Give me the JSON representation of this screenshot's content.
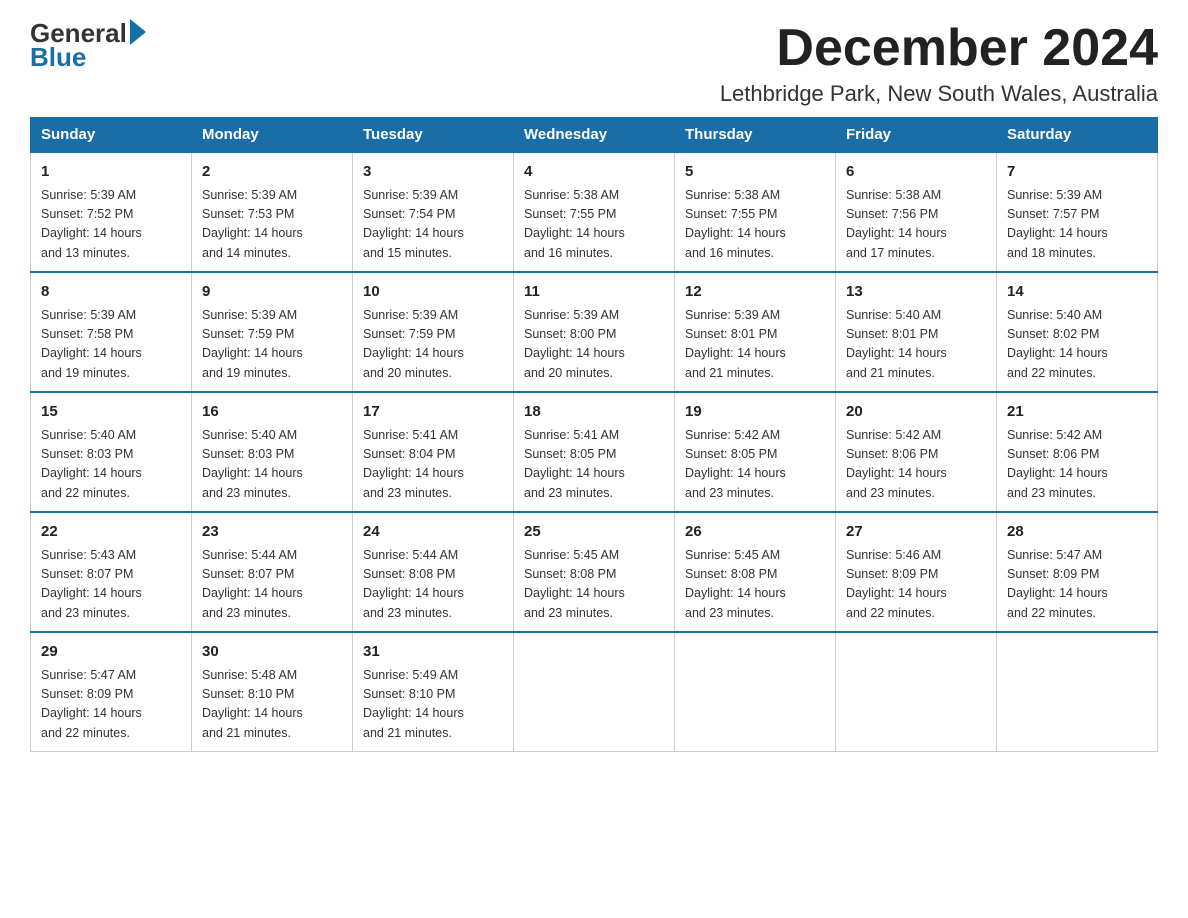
{
  "logo": {
    "general": "General",
    "blue": "Blue"
  },
  "title": {
    "month": "December 2024",
    "location": "Lethbridge Park, New South Wales, Australia"
  },
  "weekdays": [
    "Sunday",
    "Monday",
    "Tuesday",
    "Wednesday",
    "Thursday",
    "Friday",
    "Saturday"
  ],
  "weeks": [
    [
      {
        "day": "1",
        "sunrise": "5:39 AM",
        "sunset": "7:52 PM",
        "daylight": "14 hours and 13 minutes."
      },
      {
        "day": "2",
        "sunrise": "5:39 AM",
        "sunset": "7:53 PM",
        "daylight": "14 hours and 14 minutes."
      },
      {
        "day": "3",
        "sunrise": "5:39 AM",
        "sunset": "7:54 PM",
        "daylight": "14 hours and 15 minutes."
      },
      {
        "day": "4",
        "sunrise": "5:38 AM",
        "sunset": "7:55 PM",
        "daylight": "14 hours and 16 minutes."
      },
      {
        "day": "5",
        "sunrise": "5:38 AM",
        "sunset": "7:55 PM",
        "daylight": "14 hours and 16 minutes."
      },
      {
        "day": "6",
        "sunrise": "5:38 AM",
        "sunset": "7:56 PM",
        "daylight": "14 hours and 17 minutes."
      },
      {
        "day": "7",
        "sunrise": "5:39 AM",
        "sunset": "7:57 PM",
        "daylight": "14 hours and 18 minutes."
      }
    ],
    [
      {
        "day": "8",
        "sunrise": "5:39 AM",
        "sunset": "7:58 PM",
        "daylight": "14 hours and 19 minutes."
      },
      {
        "day": "9",
        "sunrise": "5:39 AM",
        "sunset": "7:59 PM",
        "daylight": "14 hours and 19 minutes."
      },
      {
        "day": "10",
        "sunrise": "5:39 AM",
        "sunset": "7:59 PM",
        "daylight": "14 hours and 20 minutes."
      },
      {
        "day": "11",
        "sunrise": "5:39 AM",
        "sunset": "8:00 PM",
        "daylight": "14 hours and 20 minutes."
      },
      {
        "day": "12",
        "sunrise": "5:39 AM",
        "sunset": "8:01 PM",
        "daylight": "14 hours and 21 minutes."
      },
      {
        "day": "13",
        "sunrise": "5:40 AM",
        "sunset": "8:01 PM",
        "daylight": "14 hours and 21 minutes."
      },
      {
        "day": "14",
        "sunrise": "5:40 AM",
        "sunset": "8:02 PM",
        "daylight": "14 hours and 22 minutes."
      }
    ],
    [
      {
        "day": "15",
        "sunrise": "5:40 AM",
        "sunset": "8:03 PM",
        "daylight": "14 hours and 22 minutes."
      },
      {
        "day": "16",
        "sunrise": "5:40 AM",
        "sunset": "8:03 PM",
        "daylight": "14 hours and 23 minutes."
      },
      {
        "day": "17",
        "sunrise": "5:41 AM",
        "sunset": "8:04 PM",
        "daylight": "14 hours and 23 minutes."
      },
      {
        "day": "18",
        "sunrise": "5:41 AM",
        "sunset": "8:05 PM",
        "daylight": "14 hours and 23 minutes."
      },
      {
        "day": "19",
        "sunrise": "5:42 AM",
        "sunset": "8:05 PM",
        "daylight": "14 hours and 23 minutes."
      },
      {
        "day": "20",
        "sunrise": "5:42 AM",
        "sunset": "8:06 PM",
        "daylight": "14 hours and 23 minutes."
      },
      {
        "day": "21",
        "sunrise": "5:42 AM",
        "sunset": "8:06 PM",
        "daylight": "14 hours and 23 minutes."
      }
    ],
    [
      {
        "day": "22",
        "sunrise": "5:43 AM",
        "sunset": "8:07 PM",
        "daylight": "14 hours and 23 minutes."
      },
      {
        "day": "23",
        "sunrise": "5:44 AM",
        "sunset": "8:07 PM",
        "daylight": "14 hours and 23 minutes."
      },
      {
        "day": "24",
        "sunrise": "5:44 AM",
        "sunset": "8:08 PM",
        "daylight": "14 hours and 23 minutes."
      },
      {
        "day": "25",
        "sunrise": "5:45 AM",
        "sunset": "8:08 PM",
        "daylight": "14 hours and 23 minutes."
      },
      {
        "day": "26",
        "sunrise": "5:45 AM",
        "sunset": "8:08 PM",
        "daylight": "14 hours and 23 minutes."
      },
      {
        "day": "27",
        "sunrise": "5:46 AM",
        "sunset": "8:09 PM",
        "daylight": "14 hours and 22 minutes."
      },
      {
        "day": "28",
        "sunrise": "5:47 AM",
        "sunset": "8:09 PM",
        "daylight": "14 hours and 22 minutes."
      }
    ],
    [
      {
        "day": "29",
        "sunrise": "5:47 AM",
        "sunset": "8:09 PM",
        "daylight": "14 hours and 22 minutes."
      },
      {
        "day": "30",
        "sunrise": "5:48 AM",
        "sunset": "8:10 PM",
        "daylight": "14 hours and 21 minutes."
      },
      {
        "day": "31",
        "sunrise": "5:49 AM",
        "sunset": "8:10 PM",
        "daylight": "14 hours and 21 minutes."
      },
      null,
      null,
      null,
      null
    ]
  ],
  "labels": {
    "sunrise": "Sunrise:",
    "sunset": "Sunset:",
    "daylight": "Daylight:"
  }
}
